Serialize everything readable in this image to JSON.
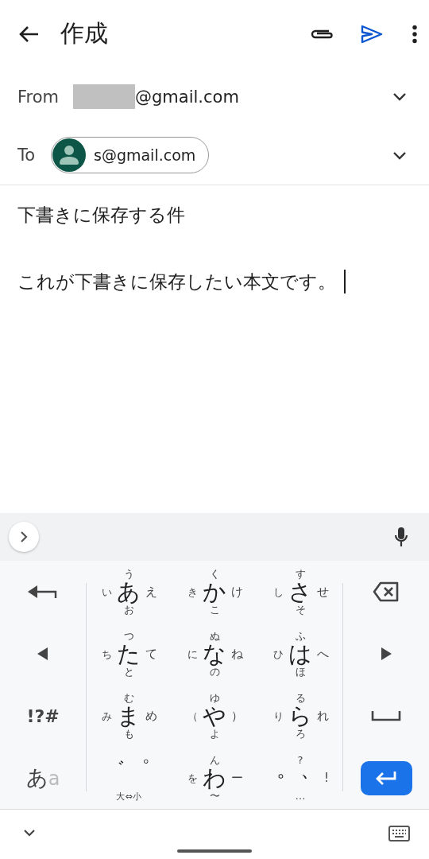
{
  "app_bar": {
    "title": "作成"
  },
  "from": {
    "label": "From",
    "redacted": true,
    "address": "@gmail.com"
  },
  "to": {
    "label": "To",
    "recipients": [
      {
        "address": "s@gmail.com"
      }
    ]
  },
  "subject": "下書きに保存する件",
  "body": "これが下書きに保存したい本文です。",
  "keyboard": {
    "kana_keys": [
      {
        "main": "あ",
        "up": "う",
        "left": "い",
        "right": "え",
        "down": "お"
      },
      {
        "main": "か",
        "up": "く",
        "left": "き",
        "right": "け",
        "down": "こ"
      },
      {
        "main": "さ",
        "up": "す",
        "left": "し",
        "right": "せ",
        "down": "そ"
      },
      {
        "main": "た",
        "up": "つ",
        "left": "ち",
        "right": "て",
        "down": "と"
      },
      {
        "main": "な",
        "up": "ぬ",
        "left": "に",
        "right": "ね",
        "down": "の"
      },
      {
        "main": "は",
        "up": "ふ",
        "left": "ひ",
        "right": "へ",
        "down": "ほ"
      },
      {
        "main": "ま",
        "up": "む",
        "left": "み",
        "right": "め",
        "down": "も"
      },
      {
        "main": "や",
        "up": "ゆ",
        "left": "（",
        "right": "）",
        "down": "よ"
      },
      {
        "main": "ら",
        "up": "る",
        "left": "り",
        "right": "れ",
        "down": "ろ"
      },
      {
        "main": "゛゜",
        "down": "大⇔小"
      },
      {
        "main": "わ",
        "up": "ん",
        "left": "を",
        "right": "ー",
        "down": "〜"
      },
      {
        "main": "。、",
        "up": "?",
        "right": "!",
        "down": "…"
      }
    ],
    "symbols_key": "!?#",
    "mode_key": {
      "primary": "あ",
      "secondary": "a"
    }
  }
}
